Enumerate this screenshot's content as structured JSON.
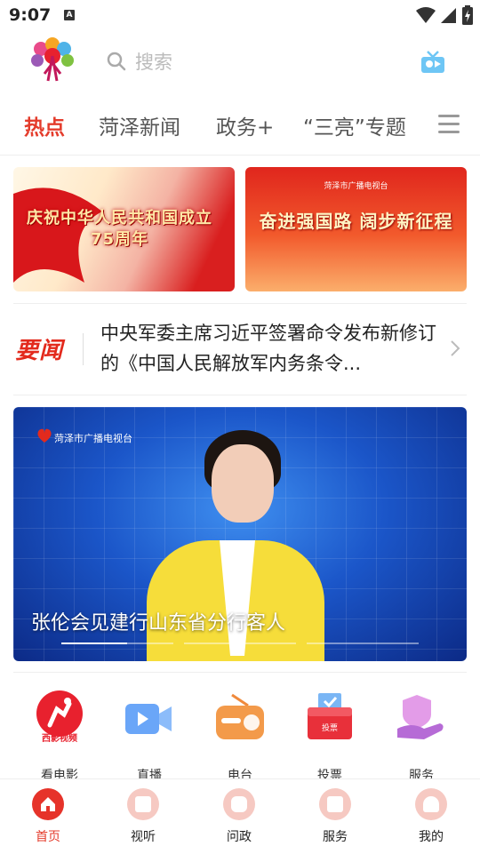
{
  "status_bar": {
    "time": "9:07",
    "notification_letter": "A"
  },
  "header": {
    "search_placeholder": "搜索"
  },
  "tabs": [
    {
      "label": "热点",
      "active": true
    },
    {
      "label": "菏泽新闻",
      "active": false
    },
    {
      "label": "政务+",
      "active": false
    },
    {
      "label": "“三亮”专题",
      "active": false
    }
  ],
  "banners": [
    {
      "title": "庆祝中华人民共和国成立75周年"
    },
    {
      "org": "菏泽市广播电视台",
      "title": "奋进强国路 阔步新征程"
    }
  ],
  "headline": {
    "tag": "要闻",
    "text": "中央军委主席习近平签署命令发布新修订的《中国人民解放军内务条令..."
  },
  "video": {
    "org": "菏泽市广播电视台",
    "caption": "张伦会见建行山东省分行客人",
    "slide_count": 3,
    "active_slide": 1
  },
  "shortcuts": [
    {
      "label": "看电影",
      "icon": "movie-icon",
      "icon_text": "西影视频"
    },
    {
      "label": "直播",
      "icon": "live-camera-icon"
    },
    {
      "label": "电台",
      "icon": "radio-icon"
    },
    {
      "label": "投票",
      "icon": "vote-box-icon",
      "icon_text": "投票"
    },
    {
      "label": "服务",
      "icon": "service-hand-icon"
    }
  ],
  "bottom_nav": [
    {
      "label": "首页",
      "icon": "home-icon",
      "active": true
    },
    {
      "label": "视听",
      "icon": "media-icon",
      "active": false
    },
    {
      "label": "问政",
      "icon": "chat-icon",
      "active": false
    },
    {
      "label": "服务",
      "icon": "service-icon",
      "active": false
    },
    {
      "label": "我的",
      "icon": "profile-icon",
      "active": false
    }
  ],
  "colors": {
    "accent": "#e43c2c",
    "tab_inactive": "#555555",
    "video_bg": "#1b56c9"
  }
}
